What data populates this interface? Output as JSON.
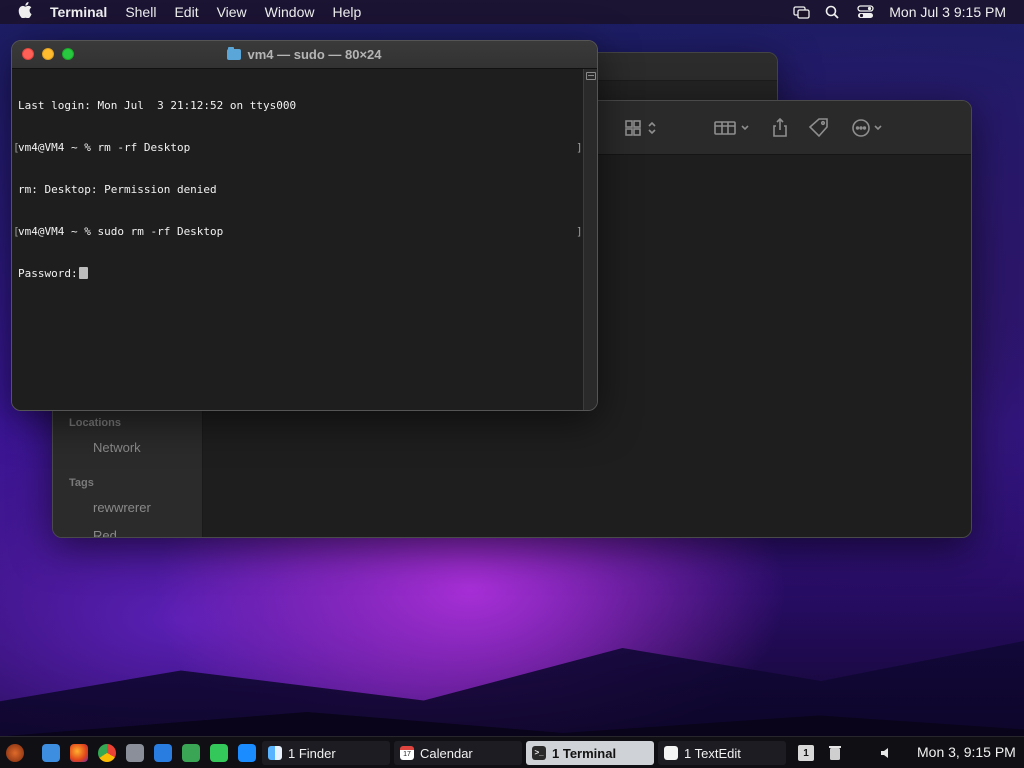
{
  "menubar": {
    "apple_icon": "apple-logo-icon",
    "app_name": "Terminal",
    "menus": [
      "Shell",
      "Edit",
      "View",
      "Window",
      "Help"
    ],
    "status_icons": [
      "screen-mirroring-icon",
      "search-icon",
      "control-center-icon"
    ],
    "clock": "Mon Jul 3  9:15 PM"
  },
  "terminal": {
    "title": "vm4 — sudo — 80×24",
    "lines": [
      "Last login: Mon Jul  3 21:12:52 on ttys000",
      "vm4@VM4 ~ % rm -rf Desktop",
      "rm: Desktop: Permission denied",
      "vm4@VM4 ~ % sudo rm -rf Desktop",
      "Password:"
    ]
  },
  "finder": {
    "sidebar": {
      "locations_header": "Locations",
      "network": "Network",
      "tags_header": "Tags",
      "tag1": "rewwrerer",
      "tag2": "Red"
    },
    "toolbar_icons": [
      "view-grid-icon",
      "group-icon",
      "share-icon",
      "tag-icon",
      "more-actions-icon",
      "search-icon"
    ]
  },
  "taskbar": {
    "tasks": {
      "finder": "1 Finder",
      "calendar": "Calendar",
      "terminal": "1 Terminal",
      "textedit": "1 TextEdit"
    },
    "calendar_day": "17",
    "workspace": "1",
    "clock": "Mon 3, 9:15 PM"
  },
  "colors": {
    "close": "#fe5f57",
    "minimize": "#febc2e",
    "maximize": "#28c840",
    "active_task": "#cfd2d6"
  }
}
